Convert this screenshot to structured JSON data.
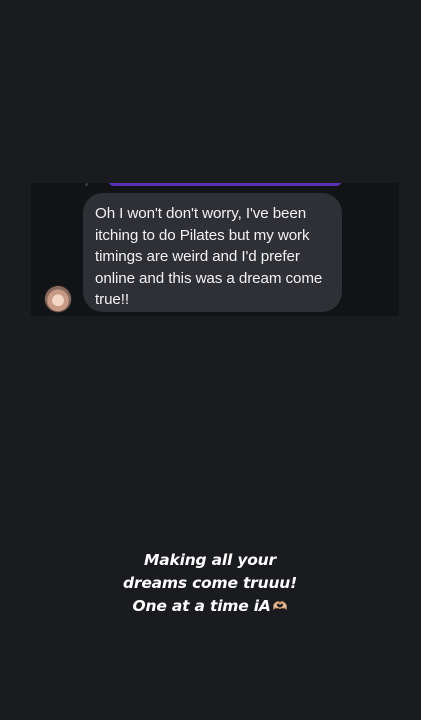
{
  "message": {
    "text": "Oh I won't don't worry, I've been itching to do Pilates but my work timings are weird and I'd prefer online and this was a dream come true!!"
  },
  "caption": {
    "line1": "Making all your",
    "line2": "dreams come truuu!",
    "line3": "One at a time iA",
    "emoji": "🫶🏼"
  },
  "colors": {
    "background": "#1a1b1e",
    "chat_background": "#111317",
    "bubble": "#2f3035",
    "accent_purple": "#5b2fb3"
  }
}
